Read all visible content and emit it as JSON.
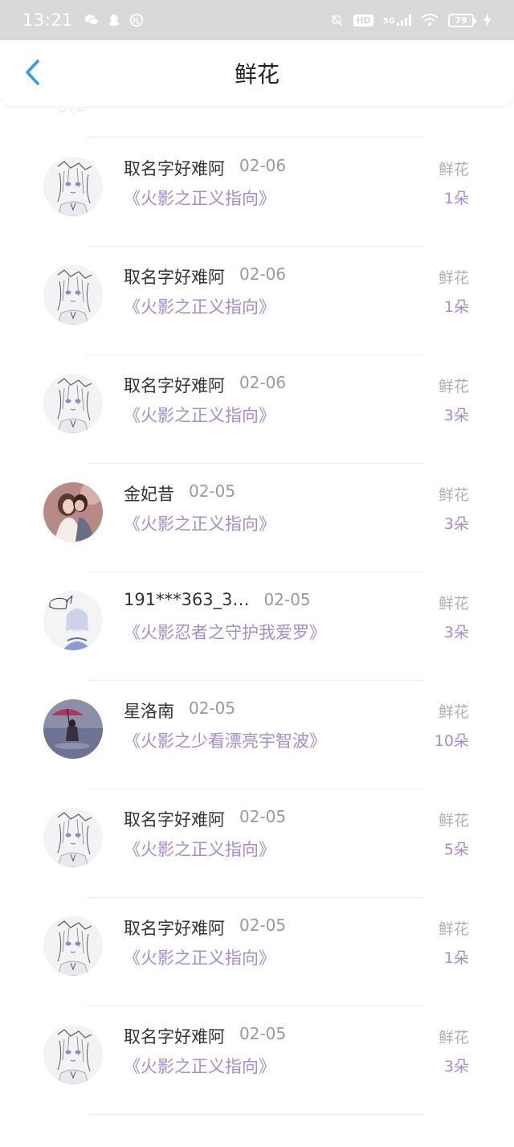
{
  "status_bar": {
    "time": "13:21",
    "network": "5G",
    "hd": "HD",
    "battery": "79"
  },
  "header": {
    "title": "鲜花",
    "back_icon": "chevron-left-icon",
    "accent": "#2f9cf2"
  },
  "colors": {
    "book_title": "#a68bd6",
    "muted": "#9a9a9a"
  },
  "items": [
    {
      "name": "取名字好难阿",
      "date": "02-06",
      "book": "《火影之正义指向》",
      "gift": "鲜花",
      "count": "1朵",
      "avatar": "sketch"
    },
    {
      "name": "取名字好难阿",
      "date": "02-06",
      "book": "《火影之正义指向》",
      "gift": "鲜花",
      "count": "1朵",
      "avatar": "sketch"
    },
    {
      "name": "取名字好难阿",
      "date": "02-06",
      "book": "《火影之正义指向》",
      "gift": "鲜花",
      "count": "3朵",
      "avatar": "sketch"
    },
    {
      "name": "金妃昔",
      "date": "02-05",
      "book": "《火影之正义指向》",
      "gift": "鲜花",
      "count": "3朵",
      "avatar": "couple"
    },
    {
      "name": "191***363_3…",
      "date": "02-05",
      "book": "《火影忍者之守护我爱罗》",
      "gift": "鲜花",
      "count": "3朵",
      "avatar": "anime"
    },
    {
      "name": "星洛南",
      "date": "02-05",
      "book": "《火影之少看漂亮宇智波》",
      "gift": "鲜花",
      "count": "10朵",
      "avatar": "umbrella"
    },
    {
      "name": "取名字好难阿",
      "date": "02-05",
      "book": "《火影之正义指向》",
      "gift": "鲜花",
      "count": "5朵",
      "avatar": "sketch"
    },
    {
      "name": "取名字好难阿",
      "date": "02-05",
      "book": "《火影之正义指向》",
      "gift": "鲜花",
      "count": "1朵",
      "avatar": "sketch"
    },
    {
      "name": "取名字好难阿",
      "date": "02-05",
      "book": "《火影之正义指向》",
      "gift": "鲜花",
      "count": "3朵",
      "avatar": "sketch"
    }
  ]
}
